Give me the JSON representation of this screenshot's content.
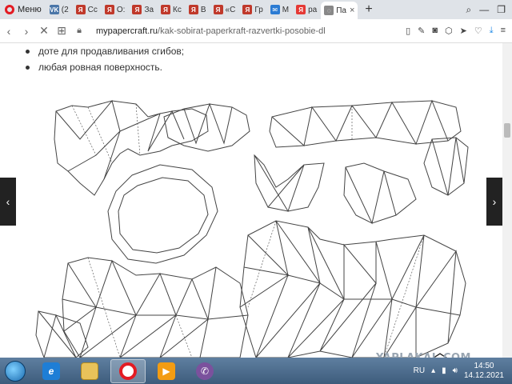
{
  "browser": {
    "menu_label": "Меню",
    "tabs": [
      {
        "label": "(2",
        "fav_text": "VK",
        "fav_color": "#4a76a8"
      },
      {
        "label": "Сс",
        "fav_text": "Я",
        "fav_color": "#c0392b"
      },
      {
        "label": "О:",
        "fav_text": "Я",
        "fav_color": "#c0392b"
      },
      {
        "label": "За",
        "fav_text": "Я",
        "fav_color": "#c0392b"
      },
      {
        "label": "Кс",
        "fav_text": "Я",
        "fav_color": "#c0392b"
      },
      {
        "label": "В",
        "fav_text": "Я",
        "fav_color": "#c0392b"
      },
      {
        "label": "«С",
        "fav_text": "Я",
        "fav_color": "#c0392b"
      },
      {
        "label": "Гр",
        "fav_text": "Я",
        "fav_color": "#c0392b"
      },
      {
        "label": "М",
        "fav_text": "✉",
        "fav_color": "#2b7bd3"
      },
      {
        "label": "ра",
        "fav_text": "Я",
        "fav_color": "#e53935"
      },
      {
        "label": "Па",
        "fav_text": "◌",
        "fav_color": "#888888",
        "active": true
      }
    ],
    "new_tab": "+",
    "url_host": "mypapercraft.ru",
    "url_path": "/kak-sobirat-paperkraft-razvertki-posobie-dl"
  },
  "page": {
    "bullets": [
      "доте для продавливания сгибов;",
      "любая ровная поверхность."
    ],
    "watermark": "YAPLAKAL.COM"
  },
  "taskbar": {
    "language": "RU",
    "time": "14:50",
    "date": "14.12.2021"
  },
  "colors": {
    "opera_red": "#e31b23",
    "taskbar": "#4a6b8c"
  }
}
